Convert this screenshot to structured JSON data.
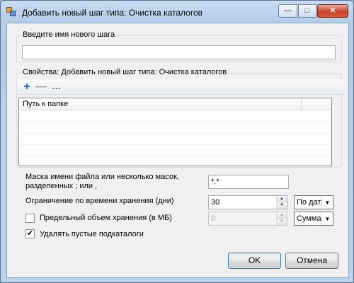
{
  "window": {
    "title": "Добавить новый шаг типа: Очистка каталогов",
    "controls": {
      "minimize": "—",
      "maximize": "□",
      "close": "✕"
    },
    "icon": "app-icon"
  },
  "step_name_group": {
    "legend": "Введите имя нового шага",
    "value": ""
  },
  "properties_group": {
    "legend": "Свойства: Добавить новый шаг типа: Очистка каталогов",
    "toolbar": {
      "add": "+",
      "remove": "—",
      "more": "..."
    },
    "grid": {
      "columns": [
        "Путь к папке",
        ""
      ],
      "rows": []
    }
  },
  "mask": {
    "label": "Маска имени файла или несколько масок, разделенных ; или ,",
    "value": "*.*"
  },
  "retention_time": {
    "label": "Ограничение по времени хранения (дни)",
    "value": "30",
    "mode": "По дат"
  },
  "retention_size": {
    "label": "Предельный объем хранения (в МБ)",
    "checked": false,
    "value": "0",
    "mode": "Сумма"
  },
  "delete_empty": {
    "label": "Удалять пустые подкаталоги",
    "checked": true,
    "mark": "✔"
  },
  "buttons": {
    "ok": "OK",
    "cancel": "Отмена"
  }
}
